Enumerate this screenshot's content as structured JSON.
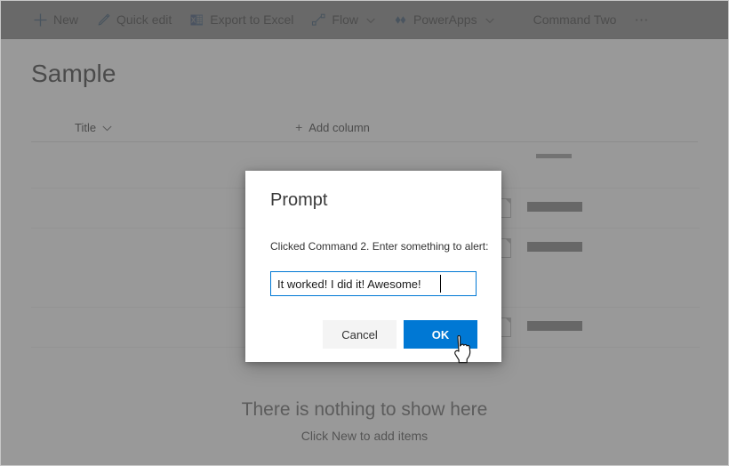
{
  "commandbar": {
    "items": [
      {
        "id": "new",
        "label": "New",
        "icon": "plus-icon",
        "chevron": false
      },
      {
        "id": "quick-edit",
        "label": "Quick edit",
        "icon": "pencil-icon",
        "chevron": false
      },
      {
        "id": "export-to-excel",
        "label": "Export to Excel",
        "icon": "excel-icon",
        "chevron": false
      },
      {
        "id": "flow",
        "label": "Flow",
        "icon": "flow-icon",
        "chevron": true
      },
      {
        "id": "powerapps",
        "label": "PowerApps",
        "icon": "powerapps-icon",
        "chevron": true
      },
      {
        "id": "command-two",
        "label": "Command Two",
        "icon": "none",
        "chevron": false
      },
      {
        "id": "overflow",
        "label": "···",
        "icon": "ellipsis-icon",
        "chevron": false
      }
    ]
  },
  "page": {
    "title": "Sample",
    "column_header": {
      "title_label": "Title",
      "add_column_label": "Add column",
      "add_column_plus": "+"
    },
    "empty_state": {
      "title": "There is nothing to show here",
      "subtitle": "Click New to add items"
    }
  },
  "dialog": {
    "title": "Prompt",
    "message": "Clicked Command 2. Enter something to alert:",
    "input_value": "It worked! I did it! Awesome!",
    "input_placeholder": "",
    "cancel_label": "Cancel",
    "ok_label": "OK"
  },
  "colors": {
    "accent": "#0078d4",
    "excel_green": "#1d6f42",
    "excel_blue": "#185abd",
    "text": "#333333",
    "overlay": "rgba(90,90,90,0.62)",
    "dialog_bg": "#ffffff"
  }
}
